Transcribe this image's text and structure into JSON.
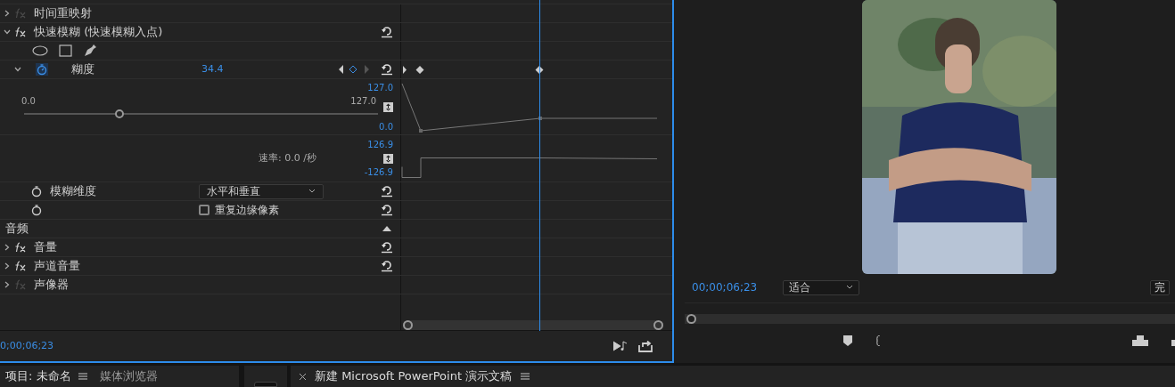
{
  "effects": [
    {
      "name": "时间重映射",
      "expanded": false,
      "enabled": false,
      "resettable": false
    },
    {
      "name": "快速模糊 (快速模糊入点)",
      "expanded": true,
      "enabled": true,
      "resettable": true
    }
  ],
  "blur_param": {
    "label": "糊度",
    "value": "34.4",
    "animated": true,
    "graph_max": "127.0",
    "graph_min": "0.0",
    "slider_min": "0.0",
    "slider_max": "127.0",
    "level": 0.27,
    "velocity_max": "126.9",
    "velocity_min": "-126.9",
    "velocity": "速率: 0.0 /秒"
  },
  "dimension": {
    "label": "模糊维度",
    "value": "水平和垂直"
  },
  "repeat_edge": {
    "label": "重复边缘像素",
    "checked": false
  },
  "audio": {
    "title": "音频",
    "effects": [
      {
        "name": "音量",
        "enabled": true,
        "resettable": true
      },
      {
        "name": "声道音量",
        "enabled": true,
        "resettable": true
      },
      {
        "name": "声像器",
        "enabled": false,
        "resettable": false
      }
    ]
  },
  "panel_timecode": "0;00;06;23",
  "monitor": {
    "timecode": "00;00;06;23",
    "zoom": "适合",
    "quality": "完"
  },
  "bottom_tabs": [
    {
      "label": "项目: 未命名",
      "selected": true
    },
    {
      "label": "媒体浏览器",
      "selected": false
    }
  ],
  "sequence_tab": "新建 Microsoft PowerPoint 演示文稿"
}
